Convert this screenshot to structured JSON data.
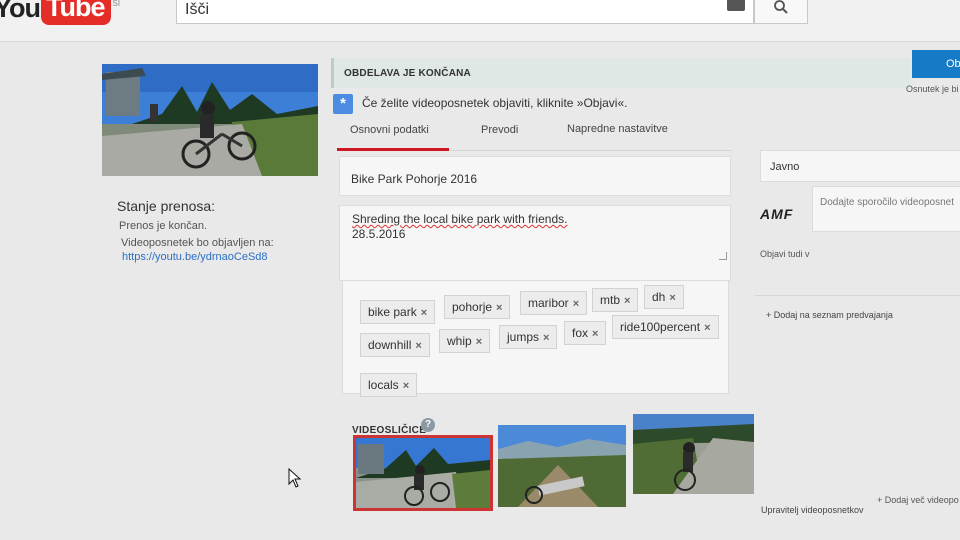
{
  "header": {
    "logo_you": "You",
    "logo_tube": "Tube",
    "logo_country": "SI",
    "search_value": "Išči"
  },
  "upload_status": {
    "title": "Stanje prenosa:",
    "status_text": "Prenos je končan.",
    "publish_note": "Videoposnetek bo objavljen na:",
    "link": "https://youtu.be/ydrnaoCeSd8"
  },
  "processing": {
    "label": "OBDELAVA JE KONČANA",
    "publish_button": "Obj",
    "draft_note": "Osnutek je bi"
  },
  "info_message": "Če želite videoposnetek objaviti, kliknite »Objavi«.",
  "tabs": [
    {
      "label": "Osnovni podatki",
      "active": true
    },
    {
      "label": "Prevodi",
      "active": false
    },
    {
      "label": "Napredne nastavitve",
      "active": false
    }
  ],
  "form": {
    "title": "Bike Park Pohorje 2016",
    "description_line1": "Shreding the local bike park with friends.",
    "description_line2": "28.5.2016",
    "tags": [
      "bike park",
      "pohorje",
      "maribor",
      "mtb",
      "dh",
      "downhill",
      "whip",
      "jumps",
      "fox",
      "ride100percent",
      "locals"
    ],
    "tag_remove_glyph": "×"
  },
  "thumbnails": {
    "title": "VIDEOSLIČICE",
    "help_glyph": "?",
    "selected_index": 0
  },
  "right_panel": {
    "privacy": "Javno",
    "channel_logo_text": "AMF",
    "message_placeholder": "Dodajte sporočilo videoposnet",
    "share_label": "Objavi tudi v",
    "playlist_link": "+ Dodaj na seznam predvajanja",
    "manage_link": "Upravitelj videoposnetkov",
    "add_more_link": "+ Dodaj več videopo"
  },
  "colors": {
    "accent_red": "#cc181e",
    "link_blue": "#2b6fc4",
    "publish_blue": "#167ac6",
    "processing_bg": "#dfe8e4"
  },
  "icons": {
    "search": "search-icon",
    "keyboard": "keyboard-icon",
    "info": "info-icon",
    "help": "help-icon",
    "cursor": "mouse-cursor-icon"
  }
}
